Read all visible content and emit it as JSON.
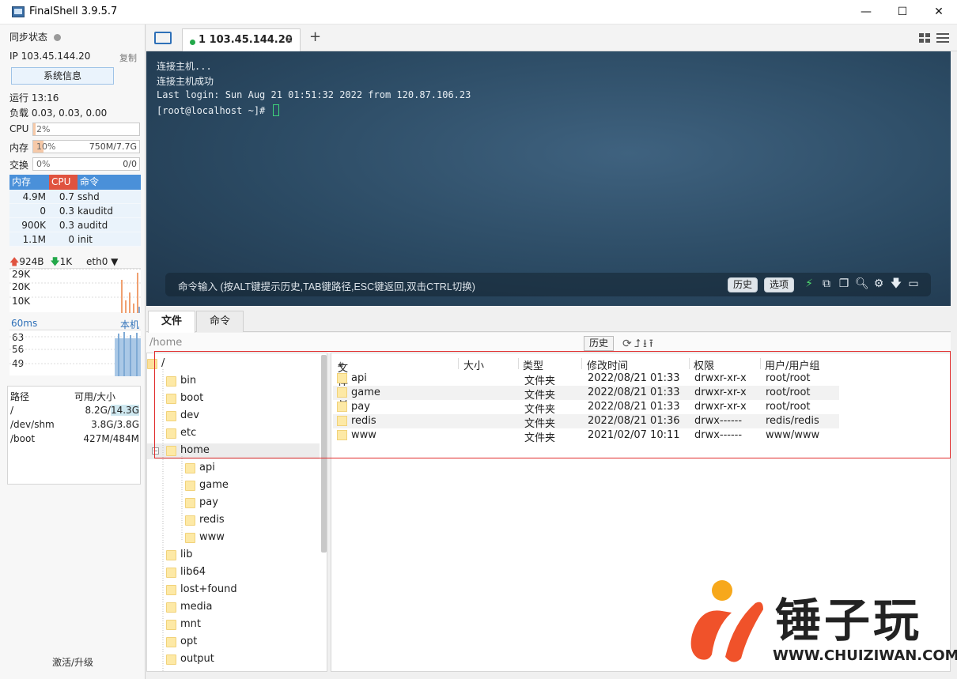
{
  "window": {
    "title": "FinalShell 3.9.5.7",
    "min": "—",
    "max": "☐",
    "close": "✕"
  },
  "left": {
    "sync_label": "同步状态",
    "ip_label": "IP 103.45.144.20",
    "copy": "复制",
    "sysinfo_button": "系统信息",
    "uptime": "运行 13:16",
    "load": "负载 0.03, 0.03, 0.00",
    "cpu": {
      "label": "CPU",
      "value": "2%"
    },
    "mem": {
      "label": "内存",
      "value": "10%",
      "detail": "750M/7.7G"
    },
    "swap": {
      "label": "交换",
      "value": "0%",
      "detail": "0/0"
    },
    "proc_headers": [
      "内存",
      "CPU",
      "命令"
    ],
    "processes": [
      {
        "mem": "4.9M",
        "cpu": "0.7",
        "cmd": "sshd"
      },
      {
        "mem": "0",
        "cpu": "0.3",
        "cmd": "kauditd"
      },
      {
        "mem": "900K",
        "cpu": "0.3",
        "cmd": "auditd"
      },
      {
        "mem": "1.1M",
        "cpu": "0",
        "cmd": "init"
      }
    ],
    "net_up": "924B",
    "net_down": "1K",
    "net_iface": "eth0",
    "net_ticks": [
      "29K",
      "20K",
      "10K"
    ],
    "latency": "60ms",
    "latency_target": "本机",
    "latency_ticks": [
      "63",
      "56",
      "49"
    ],
    "disk_headers": [
      "路径",
      "可用/大小"
    ],
    "disks": [
      {
        "path": "/",
        "avail": "8.2G",
        "size": "14.3G"
      },
      {
        "path": "/dev/shm",
        "avail": "3.8G",
        "size": "3.8G"
      },
      {
        "path": "/boot",
        "avail": "427M",
        "size": "484M"
      }
    ],
    "activate": "激活/升级"
  },
  "tabs": {
    "session_label": "1 103.45.144.20",
    "close": "×",
    "add": "+"
  },
  "terminal": {
    "lines": [
      "连接主机...",
      "连接主机成功",
      "Last login: Sun Aug 21 01:51:32 2022 from 120.87.106.23",
      "[root@localhost ~]# "
    ],
    "cmd_placeholder": "命令输入 (按ALT键提示历史,TAB键路径,ESC键返回,双击CTRL切换)",
    "history_btn": "历史",
    "options_btn": "选项"
  },
  "bottom": {
    "tab_files": "文件",
    "tab_commands": "命令",
    "path": "/home",
    "history_btn": "历史"
  },
  "tree": [
    {
      "name": "/",
      "depth": 0
    },
    {
      "name": "bin",
      "depth": 1
    },
    {
      "name": "boot",
      "depth": 1
    },
    {
      "name": "dev",
      "depth": 1
    },
    {
      "name": "etc",
      "depth": 1
    },
    {
      "name": "home",
      "depth": 1
    },
    {
      "name": "api",
      "depth": 2
    },
    {
      "name": "game",
      "depth": 2
    },
    {
      "name": "pay",
      "depth": 2
    },
    {
      "name": "redis",
      "depth": 2
    },
    {
      "name": "www",
      "depth": 2
    },
    {
      "name": "lib",
      "depth": 1
    },
    {
      "name": "lib64",
      "depth": 1
    },
    {
      "name": "lost+found",
      "depth": 1
    },
    {
      "name": "media",
      "depth": 1
    },
    {
      "name": "mnt",
      "depth": 1
    },
    {
      "name": "opt",
      "depth": 1
    },
    {
      "name": "output",
      "depth": 1
    }
  ],
  "files": {
    "headers": [
      "文件名",
      "大小",
      "类型",
      "修改时间",
      "权限",
      "用户/用户组"
    ],
    "rows": [
      {
        "name": "api",
        "size": "",
        "type": "文件夹",
        "mtime": "2022/08/21 01:33",
        "perm": "drwxr-xr-x",
        "owner": "root/root"
      },
      {
        "name": "game",
        "size": "",
        "type": "文件夹",
        "mtime": "2022/08/21 01:33",
        "perm": "drwxr-xr-x",
        "owner": "root/root"
      },
      {
        "name": "pay",
        "size": "",
        "type": "文件夹",
        "mtime": "2022/08/21 01:33",
        "perm": "drwxr-xr-x",
        "owner": "root/root"
      },
      {
        "name": "redis",
        "size": "",
        "type": "文件夹",
        "mtime": "2022/08/21 01:36",
        "perm": "drwx------",
        "owner": "redis/redis"
      },
      {
        "name": "www",
        "size": "",
        "type": "文件夹",
        "mtime": "2021/02/07 10:11",
        "perm": "drwx------",
        "owner": "www/www"
      }
    ]
  },
  "watermark": {
    "brand": "锤子玩",
    "url": "WWW.CHUIZIWAN.COM"
  },
  "colors": {
    "accent": "#4a90d9",
    "cpu_header": "#e0533f",
    "mem_fill": "#f6c9a8",
    "online": "#23a84a",
    "watermark_orange": "#f0522a"
  }
}
